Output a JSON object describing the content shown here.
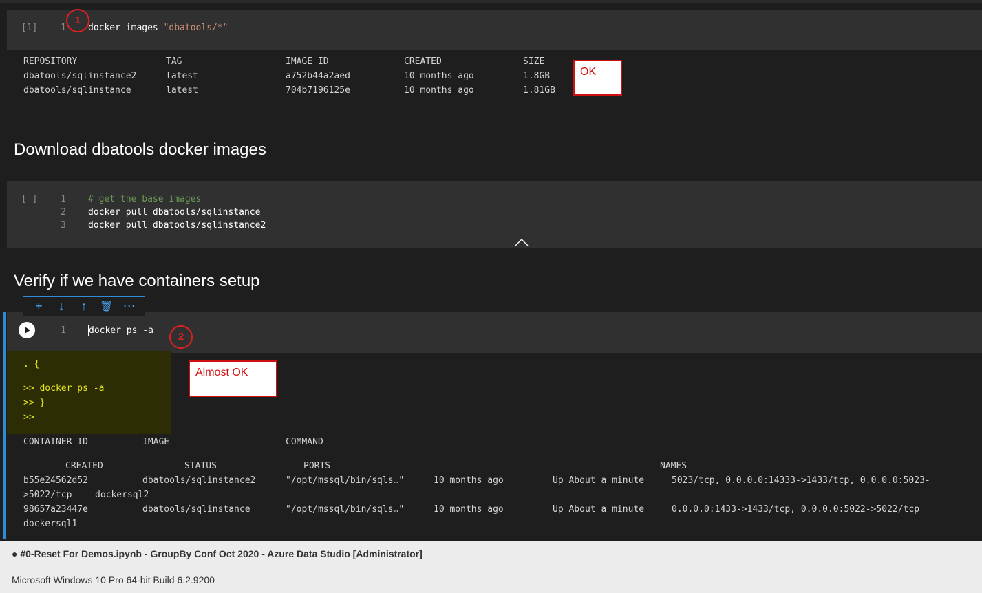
{
  "cell1": {
    "exec_count": "[1]",
    "line": "1",
    "code_cmd": "docker images ",
    "code_str": "\"dbatools/*\"",
    "output": {
      "headers": [
        "REPOSITORY",
        "TAG",
        "IMAGE ID",
        "CREATED",
        "SIZE"
      ],
      "rows": [
        [
          "dbatools/sqlinstance2",
          "latest",
          "a752b44a2aed",
          "10 months ago",
          "1.8GB"
        ],
        [
          "dbatools/sqlinstance",
          "latest",
          "704b7196125e",
          "10 months ago",
          "1.81GB"
        ]
      ]
    }
  },
  "annotation1": {
    "number": "1",
    "note": "OK"
  },
  "heading1": "Download dbatools docker images",
  "cell2": {
    "exec_count": "[ ]",
    "lines": [
      {
        "num": "1",
        "text": "# get the base images"
      },
      {
        "num": "2",
        "text": "docker pull dbatools/sqlinstance"
      },
      {
        "num": "3",
        "text": "docker pull dbatools/sqlinstance2"
      }
    ]
  },
  "heading2": "Verify if we have containers setup",
  "toolbar": {
    "add": "+",
    "down": "↓",
    "up": "↑",
    "delete": "🗑",
    "more": "⋯"
  },
  "cell3": {
    "line": "1",
    "code": "docker ps -a",
    "echo": [
      ". {",
      ">> docker ps -a",
      ">> }",
      ">>"
    ],
    "output": {
      "header1": [
        "CONTAINER ID",
        "IMAGE",
        "COMMAND"
      ],
      "header2": [
        "CREATED",
        "STATUS",
        "PORTS",
        "NAMES"
      ],
      "rows": [
        {
          "id": "b55e24562d52",
          "image": "dbatools/sqlinstance2",
          "command": "\"/opt/mssql/bin/sqls…\"",
          "created": "10 months ago",
          "status": "Up About a minute",
          "ports": "5023/tcp, 0.0.0.0:14333->1433/tcp, 0.0.0.0:5023-",
          "ports_wrap": ">5022/tcp",
          "name": "dockersql2"
        },
        {
          "id": "98657a23447e",
          "image": "dbatools/sqlinstance",
          "command": "\"/opt/mssql/bin/sqls…\"",
          "created": "10 months ago",
          "status": "Up About a minute",
          "ports": "0.0.0.0:1433->1433/tcp, 0.0.0.0:5022->5022/tcp",
          "name": "dockersql1"
        }
      ]
    }
  },
  "annotation2": {
    "number": "2",
    "note": "Almost OK"
  },
  "footer": {
    "title": "● #0-Reset For Demos.ipynb - GroupBy Conf Oct 2020 - Azure Data Studio [Administrator]",
    "os": "Microsoft Windows 10 Pro 64-bit Build 6.2.9200"
  }
}
